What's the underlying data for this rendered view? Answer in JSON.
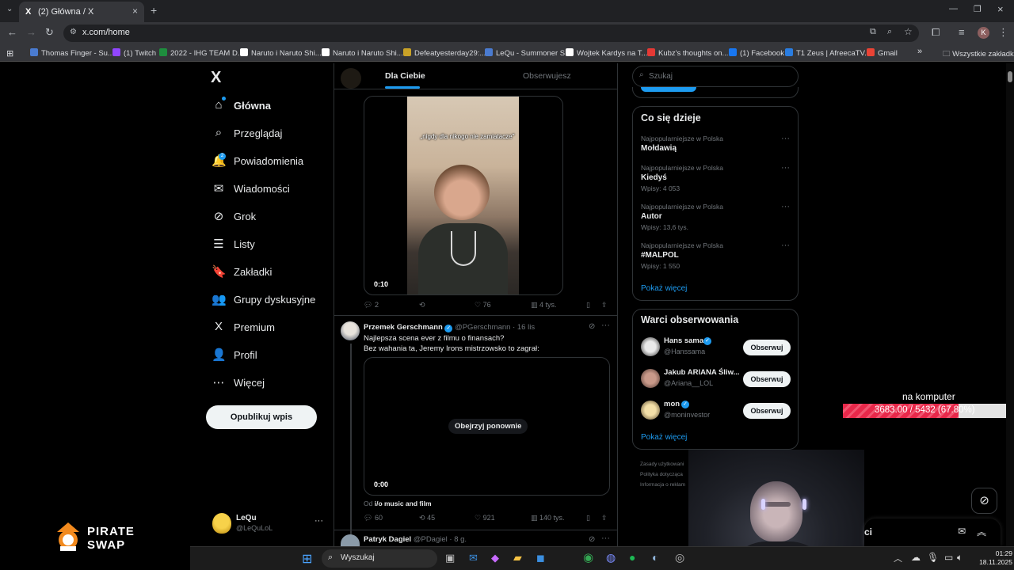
{
  "browser": {
    "tab_title": "(2) Główna / X",
    "tab_icon": "X",
    "url": "x.com/home",
    "bookmarks": [
      {
        "label": "Thomas Finger - Su...",
        "color": "#4a7bd0"
      },
      {
        "label": "(1) Twitch",
        "color": "#9146ff"
      },
      {
        "label": "2022 - IHG TEAM D...",
        "color": "#1e8e3e"
      },
      {
        "label": "Naruto i Naruto Shi...",
        "color": "#ffffff"
      },
      {
        "label": "Naruto i Naruto Shi...",
        "color": "#ffffff"
      },
      {
        "label": "Defeatyesterday29:...",
        "color": "#c9a227"
      },
      {
        "label": "LeQu - Summoner S...",
        "color": "#4a7bd0"
      },
      {
        "label": "Wojtek Kardys na T...",
        "color": "#ffffff"
      },
      {
        "label": "Kubz's thoughts on...",
        "color": "#e53935"
      },
      {
        "label": "(1) Facebook",
        "color": "#1877f2"
      },
      {
        "label": "T1 Zeus | AfreecaTV...",
        "color": "#2a7de1"
      },
      {
        "label": "Gmail",
        "color": "#ea4335"
      }
    ],
    "all_bookmarks": "Wszystkie zakładki",
    "profile_initial": "K"
  },
  "nav": {
    "logo": "X",
    "items": [
      {
        "label": "Główna",
        "icon": "home-icon",
        "glyph": "⌂"
      },
      {
        "label": "Przeglądaj",
        "icon": "search-icon",
        "glyph": "⌕"
      },
      {
        "label": "Powiadomienia",
        "icon": "bell-icon",
        "glyph": "🔔"
      },
      {
        "label": "Wiadomości",
        "icon": "mail-icon",
        "glyph": "✉"
      },
      {
        "label": "Grok",
        "icon": "grok-icon",
        "glyph": "⊘"
      },
      {
        "label": "Listy",
        "icon": "list-icon",
        "glyph": "☰"
      },
      {
        "label": "Zakładki",
        "icon": "bookmark-icon",
        "glyph": "🔖"
      },
      {
        "label": "Grupy dyskusyjne",
        "icon": "communities-icon",
        "glyph": "👥"
      },
      {
        "label": "Premium",
        "icon": "x-premium-icon",
        "glyph": "X"
      },
      {
        "label": "Profil",
        "icon": "profile-icon",
        "glyph": "👤"
      },
      {
        "label": "Więcej",
        "icon": "more-circle-icon",
        "glyph": "⋯"
      }
    ],
    "notifications_badge": "2",
    "publish": "Opublikuj wpis",
    "account_name": "LeQu",
    "account_handle": "@LeQuLoL"
  },
  "feed": {
    "tab_for_you": "Dla Ciebie",
    "tab_following": "Obserwujesz",
    "post1": {
      "video_caption": "„nigdy dla nikogo nie zamiatacze\"",
      "duration": "0:10",
      "replies": "2",
      "likes": "76",
      "views": "4 tys."
    },
    "post2": {
      "author": "Przemek Gerschmann",
      "handle": "@PGerschmann",
      "date": "· 16 lis",
      "text_line1": "Najlepsza scena ever z filmu o finansach?",
      "text_line2": "Bez wahania ta, Jeremy Irons mistrzowsko to zagrał:",
      "replay": "Obejrzyj ponownie",
      "duration": "0:00",
      "from_prefix": "Od",
      "from_source": "i/o music and film",
      "replies": "60",
      "reposts": "45",
      "likes": "921",
      "views": "140 tys."
    },
    "post3": {
      "author": "Patryk Dagiel",
      "handle": "@PDagiel",
      "date": "· 8 g."
    }
  },
  "right": {
    "search_placeholder": "Szukaj",
    "trending_title": "Co się dzieje",
    "trends": [
      {
        "context": "Najpopularniejsze w Polska",
        "name": "Mołdawią",
        "meta": ""
      },
      {
        "context": "Najpopularniejsze w Polska",
        "name": "Kiedyś",
        "meta": "Wpisy: 4 053"
      },
      {
        "context": "Najpopularniejsze w Polska",
        "name": "Autor",
        "meta": "Wpisy: 13,6 tys."
      },
      {
        "context": "Najpopularniejsze w Polska",
        "name": "#MALPOL",
        "meta": "Wpisy: 1 550"
      }
    ],
    "show_more": "Pokaż więcej",
    "who_to_follow_title": "Warci obserwowania",
    "suggestions": [
      {
        "name": "Hans sama",
        "handle": "@Hanssama",
        "follow": "Obserwuj"
      },
      {
        "name": "Jakub ARIANA Śliw...",
        "handle": "@Ariana__LOL",
        "follow": "Obserwuj"
      },
      {
        "name": "mon",
        "handle": "@moninvestor",
        "follow": "Obserwuj"
      }
    ],
    "show_more2": "Pokaż więcej",
    "footer": [
      "Zasady użytkowani",
      "Polityka dotycząca",
      "Informacja o reklam"
    ]
  },
  "overlay": {
    "goal_label": "na komputer",
    "goal_value": "3683.00 / 5432 (67.80%)",
    "goal_progress": 0.678,
    "brand_line1": "PIRATE",
    "brand_line2": "SWAP",
    "msg_drawer": "ci"
  },
  "taskbar": {
    "search": "Wyszukaj",
    "time": "01:29",
    "date": "18.11.2025"
  }
}
